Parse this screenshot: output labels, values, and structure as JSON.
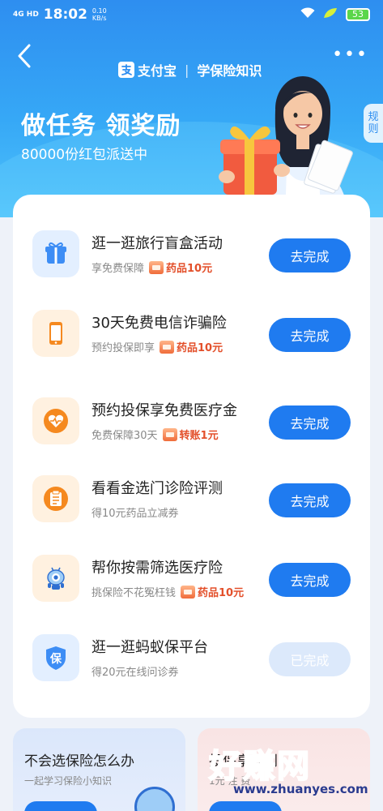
{
  "status_bar": {
    "network": "4G HD",
    "time": "18:02",
    "speed": "0.10\nKB/s",
    "battery": "53"
  },
  "header": {
    "brand": "支付宝",
    "section": "学保险知识",
    "title": "做任务 领奖励",
    "subtitle": "80000份红包派送中",
    "rules": "规则"
  },
  "tasks": [
    {
      "title": "逛一逛旅行盲盒活动",
      "desc": "享免费保障",
      "reward": "药品10元",
      "button": "去完成",
      "icon": "gift-icon",
      "icon_color": "#3d8df5",
      "icon_bg": "#e3efff"
    },
    {
      "title": "30天免费电信诈骗险",
      "desc": "预约投保即享",
      "reward": "药品10元",
      "button": "去完成",
      "icon": "phone-icon",
      "icon_color": "#f5891f",
      "icon_bg": "#fff1e0"
    },
    {
      "title": "预约投保享免费医疗金",
      "desc": "免费保障30天",
      "reward": "转账1元",
      "button": "去完成",
      "icon": "heart-icon",
      "icon_color": "#f5891f",
      "icon_bg": "#fff1e0"
    },
    {
      "title": "看看金选门诊险评测",
      "desc": "得10元药品立减券",
      "reward": "",
      "button": "去完成",
      "icon": "clipboard-icon",
      "icon_color": "#f5891f",
      "icon_bg": "#fff1e0"
    },
    {
      "title": "帮你按需筛选医疗险",
      "desc": "挑保险不花冤枉钱",
      "reward": "药品10元",
      "button": "去完成",
      "icon": "robot-mascot-icon",
      "icon_color": "#3d8df5",
      "icon_bg": "#fff1e0"
    },
    {
      "title": "逛一逛蚂蚁保平台",
      "desc": "得20元在线问诊券",
      "reward": "",
      "button": "已完成",
      "icon": "shield-icon",
      "icon_color": "#3d8df5",
      "icon_bg": "#e3efff"
    }
  ],
  "bottom_cards": [
    {
      "title": "不会选保险怎么办",
      "subtitle": "一起学习保险小知识"
    },
    {
      "title": "投保享福利",
      "subtitle": "1元 注 费"
    }
  ],
  "watermark": {
    "text": "好赚网",
    "url": "www.zhuanyes.com"
  },
  "colors": {
    "primary": "#1f7bf0",
    "reward": "#e3502b",
    "header_top": "#2e8ef0"
  }
}
